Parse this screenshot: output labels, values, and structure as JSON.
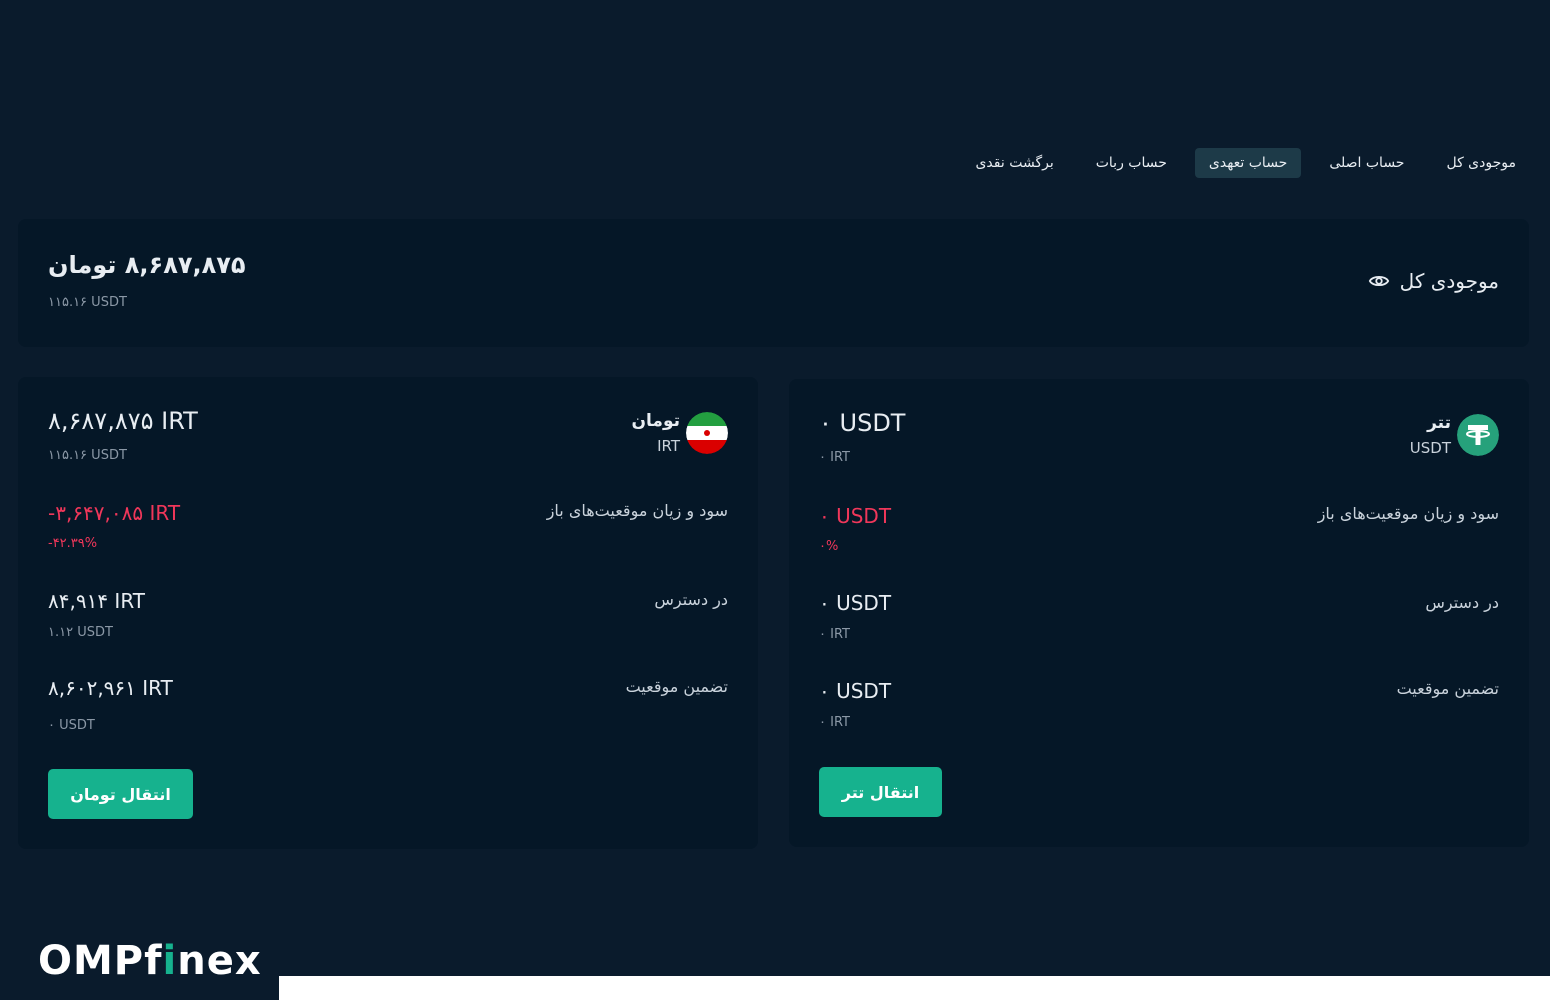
{
  "tabs": [
    {
      "label": "موجودی کل",
      "active": false
    },
    {
      "label": "حساب اصلی",
      "active": false
    },
    {
      "label": "حساب تعهدی",
      "active": true
    },
    {
      "label": "حساب ربات",
      "active": false
    },
    {
      "label": "برگشت نقدی",
      "active": false
    }
  ],
  "total": {
    "label": "موجودی کل",
    "amount": "۸,۶۸۷,۸۷۵ تومان",
    "sub": "۱۱۵.۱۶ USDT"
  },
  "toman": {
    "name": "تومان",
    "symbol": "IRT",
    "balance": "۸,۶۸۷,۸۷۵ IRT",
    "balance_sub": "۱۱۵.۱۶ USDT",
    "pnl_label": "سود و زیان موقعیت‌های باز",
    "pnl_value": "-۳,۶۴۷,۰۸۵ IRT",
    "pnl_percent": "-۴۲.۳۹%",
    "available_label": "در دسترس",
    "available_value": "۸۴,۹۱۴ IRT",
    "available_sub": "۱.۱۲ USDT",
    "margin_label": "تضمین موقعیت",
    "margin_value": "۸,۶۰۲,۹۶۱ IRT",
    "margin_sub": "۰ USDT",
    "button": "انتقال تومان"
  },
  "tether": {
    "name": "تتر",
    "symbol": "USDT",
    "balance": "۰ USDT",
    "balance_sub": "۰ IRT",
    "pnl_label": "سود و زیان موقعیت‌های باز",
    "pnl_value": "۰ USDT",
    "pnl_percent": "۰%",
    "available_label": "در دسترس",
    "available_value": "۰ USDT",
    "available_sub": "۰ IRT",
    "margin_label": "تضمین موقعیت",
    "margin_value": "۰ USDT",
    "margin_sub": "۰ IRT",
    "button": "انتقال تتر"
  },
  "brand": {
    "pre": "OMPf",
    "accent": "i",
    "post": "nex"
  },
  "colors": {
    "background": "#0a1b2c",
    "card": "#051727",
    "accent": "#16b28e",
    "negative": "#f0375a"
  }
}
